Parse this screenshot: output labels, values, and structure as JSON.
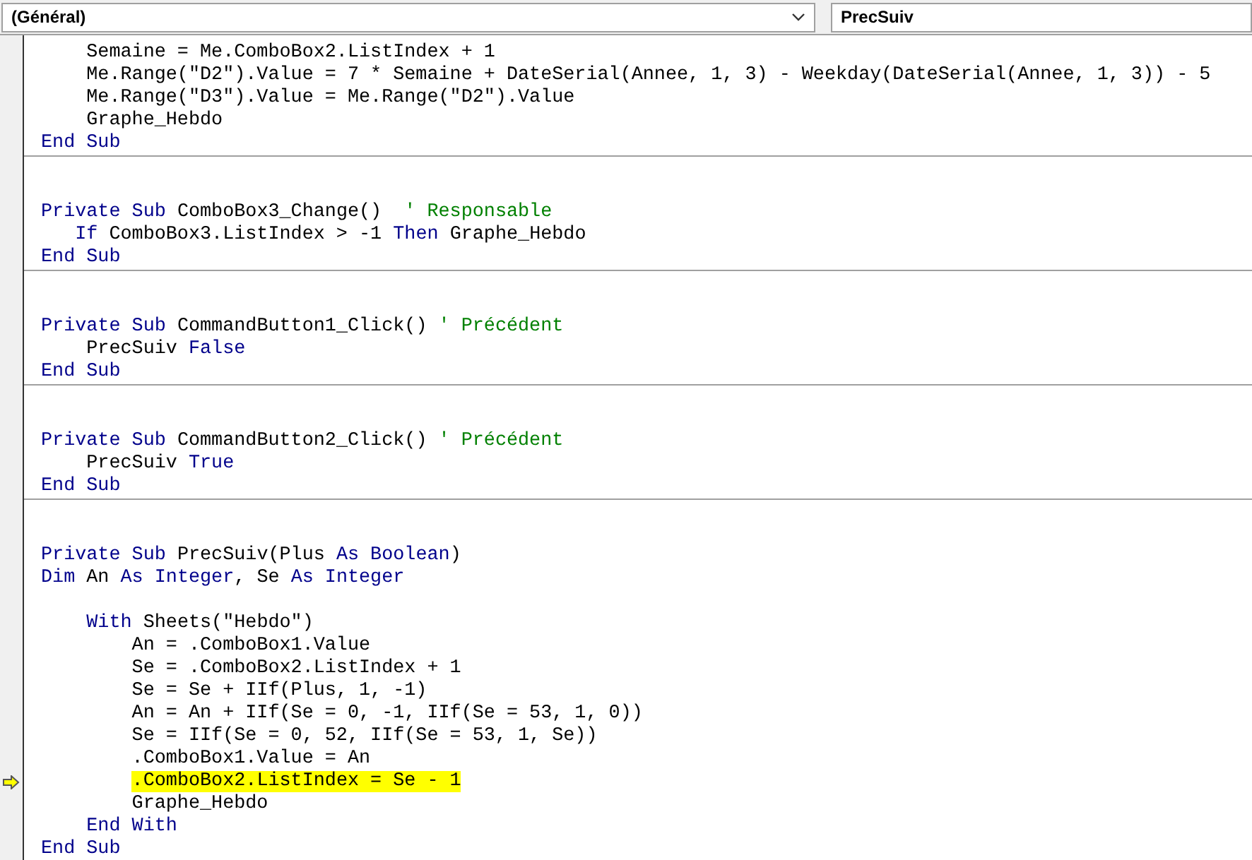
{
  "object_dropdown": {
    "value": "(Général)"
  },
  "procedure_dropdown": {
    "value": "PrecSuiv"
  },
  "procedures": [
    {
      "lines": [
        {
          "kind": "code",
          "current": false,
          "tokens": [
            {
              "text": "    Semaine = Me.ComboBox2.ListIndex + 1",
              "kind": "plain"
            }
          ]
        },
        {
          "kind": "code",
          "current": false,
          "tokens": [
            {
              "text": "    Me.Range(\"D2\").Value = 7 * Semaine + DateSerial(Annee, 1, 3) - Weekday(DateSerial(Annee, 1, 3)) - 5",
              "kind": "plain"
            }
          ]
        },
        {
          "kind": "code",
          "current": false,
          "tokens": [
            {
              "text": "    Me.Range(\"D3\").Value = Me.Range(\"D2\").Value",
              "kind": "plain"
            }
          ]
        },
        {
          "kind": "code",
          "current": false,
          "tokens": [
            {
              "text": "    Graphe_Hebdo",
              "kind": "plain"
            }
          ]
        },
        {
          "kind": "code",
          "current": false,
          "tokens": [
            {
              "text": "End Sub",
              "kind": "keyword"
            }
          ]
        }
      ]
    },
    {
      "lines": [
        {
          "kind": "blank"
        },
        {
          "kind": "blank"
        },
        {
          "kind": "code",
          "current": false,
          "tokens": [
            {
              "text": "Private Sub",
              "kind": "keyword"
            },
            {
              "text": " ComboBox3_Change()  ",
              "kind": "plain"
            },
            {
              "text": "' Responsable",
              "kind": "comment"
            }
          ]
        },
        {
          "kind": "code",
          "current": false,
          "tokens": [
            {
              "text": "   If",
              "kind": "keyword"
            },
            {
              "text": " ComboBox3.ListIndex > -1 ",
              "kind": "plain"
            },
            {
              "text": "Then",
              "kind": "keyword"
            },
            {
              "text": " Graphe_Hebdo",
              "kind": "plain"
            }
          ]
        },
        {
          "kind": "code",
          "current": false,
          "tokens": [
            {
              "text": "End Sub",
              "kind": "keyword"
            }
          ]
        }
      ]
    },
    {
      "lines": [
        {
          "kind": "blank"
        },
        {
          "kind": "blank"
        },
        {
          "kind": "code",
          "current": false,
          "tokens": [
            {
              "text": "Private Sub",
              "kind": "keyword"
            },
            {
              "text": " CommandButton1_Click() ",
              "kind": "plain"
            },
            {
              "text": "' Précédent",
              "kind": "comment"
            }
          ]
        },
        {
          "kind": "code",
          "current": false,
          "tokens": [
            {
              "text": "    PrecSuiv ",
              "kind": "plain"
            },
            {
              "text": "False",
              "kind": "keyword"
            }
          ]
        },
        {
          "kind": "code",
          "current": false,
          "tokens": [
            {
              "text": "End Sub",
              "kind": "keyword"
            }
          ]
        }
      ]
    },
    {
      "lines": [
        {
          "kind": "blank"
        },
        {
          "kind": "blank"
        },
        {
          "kind": "code",
          "current": false,
          "tokens": [
            {
              "text": "Private Sub",
              "kind": "keyword"
            },
            {
              "text": " CommandButton2_Click() ",
              "kind": "plain"
            },
            {
              "text": "' Précédent",
              "kind": "comment"
            }
          ]
        },
        {
          "kind": "code",
          "current": false,
          "tokens": [
            {
              "text": "    PrecSuiv ",
              "kind": "plain"
            },
            {
              "text": "True",
              "kind": "keyword"
            }
          ]
        },
        {
          "kind": "code",
          "current": false,
          "tokens": [
            {
              "text": "End Sub",
              "kind": "keyword"
            }
          ]
        }
      ]
    },
    {
      "lines": [
        {
          "kind": "blank"
        },
        {
          "kind": "blank"
        },
        {
          "kind": "code",
          "current": false,
          "tokens": [
            {
              "text": "Private Sub",
              "kind": "keyword"
            },
            {
              "text": " PrecSuiv(Plus ",
              "kind": "plain"
            },
            {
              "text": "As Boolean",
              "kind": "keyword"
            },
            {
              "text": ")",
              "kind": "plain"
            }
          ]
        },
        {
          "kind": "code",
          "current": false,
          "tokens": [
            {
              "text": "Dim",
              "kind": "keyword"
            },
            {
              "text": " An ",
              "kind": "plain"
            },
            {
              "text": "As Integer",
              "kind": "keyword"
            },
            {
              "text": ", Se ",
              "kind": "plain"
            },
            {
              "text": "As Integer",
              "kind": "keyword"
            }
          ]
        },
        {
          "kind": "blank"
        },
        {
          "kind": "code",
          "current": false,
          "tokens": [
            {
              "text": "    With",
              "kind": "keyword"
            },
            {
              "text": " Sheets(\"Hebdo\")",
              "kind": "plain"
            }
          ]
        },
        {
          "kind": "code",
          "current": false,
          "tokens": [
            {
              "text": "        An = .ComboBox1.Value",
              "kind": "plain"
            }
          ]
        },
        {
          "kind": "code",
          "current": false,
          "tokens": [
            {
              "text": "        Se = .ComboBox2.ListIndex + 1",
              "kind": "plain"
            }
          ]
        },
        {
          "kind": "code",
          "current": false,
          "tokens": [
            {
              "text": "        Se = Se + IIf(Plus, 1, -1)",
              "kind": "plain"
            }
          ]
        },
        {
          "kind": "code",
          "current": false,
          "tokens": [
            {
              "text": "        An = An + IIf(Se = 0, -1, IIf(Se = 53, 1, 0))",
              "kind": "plain"
            }
          ]
        },
        {
          "kind": "code",
          "current": false,
          "tokens": [
            {
              "text": "        Se = IIf(Se = 0, 52, IIf(Se = 53, 1, Se))",
              "kind": "plain"
            }
          ]
        },
        {
          "kind": "code",
          "current": false,
          "tokens": [
            {
              "text": "        .ComboBox1.Value = An",
              "kind": "plain"
            }
          ]
        },
        {
          "kind": "code",
          "current": true,
          "tokens": [
            {
              "text": "        .ComboBox2.ListIndex = Se - 1",
              "kind": "plain"
            }
          ]
        },
        {
          "kind": "code",
          "current": false,
          "tokens": [
            {
              "text": "        Graphe_Hebdo",
              "kind": "plain"
            }
          ]
        },
        {
          "kind": "code",
          "current": false,
          "tokens": [
            {
              "text": "    End With",
              "kind": "keyword"
            }
          ]
        },
        {
          "kind": "code",
          "current": false,
          "tokens": [
            {
              "text": "End Sub",
              "kind": "keyword"
            }
          ]
        }
      ]
    }
  ]
}
